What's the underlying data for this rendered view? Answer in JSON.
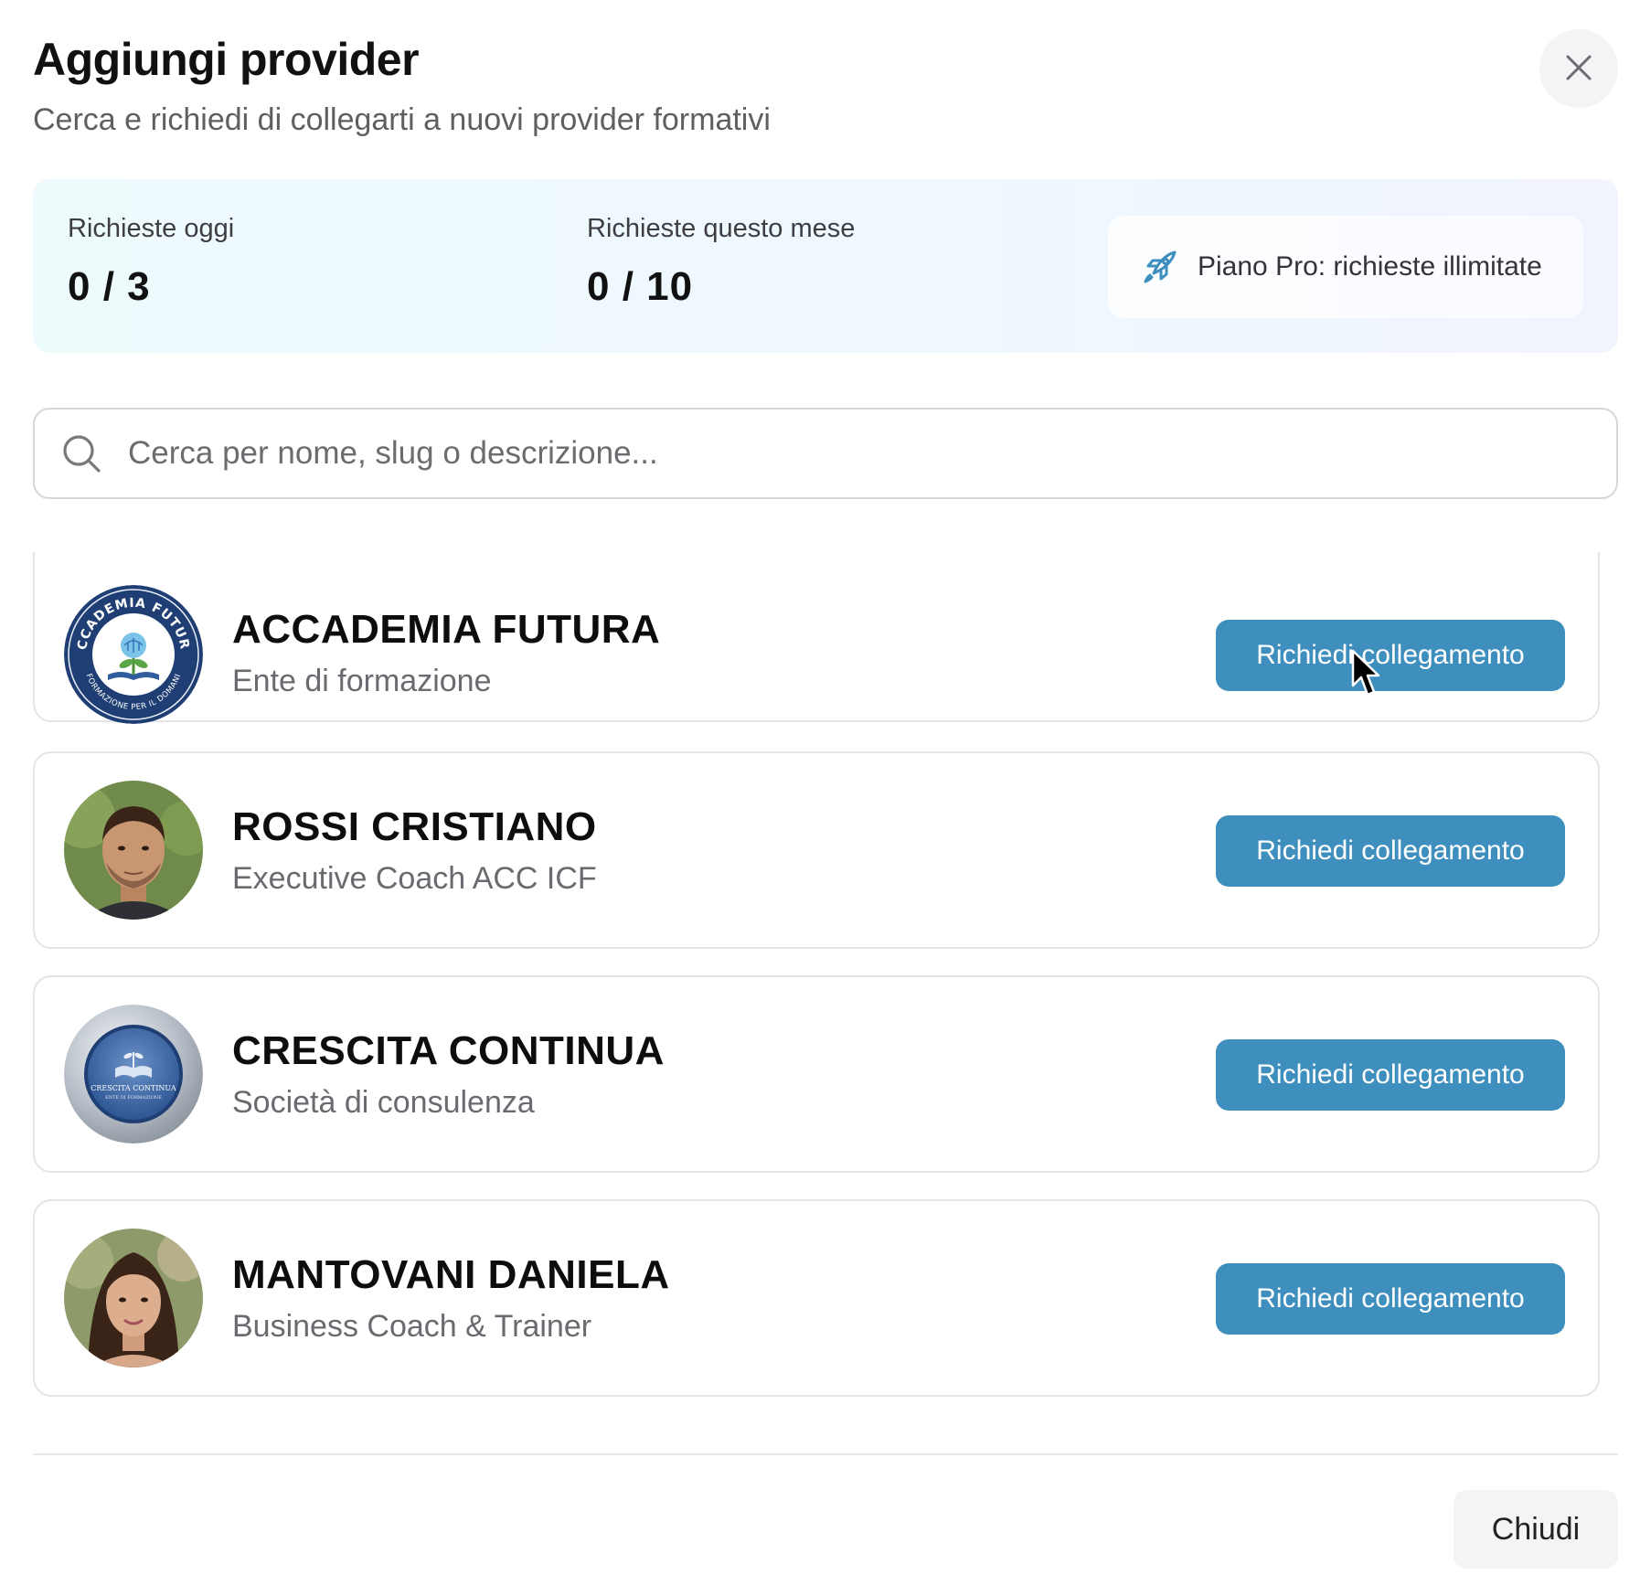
{
  "dialog": {
    "title": "Aggiungi provider",
    "subtitle": "Cerca e richiedi di collegarti a nuovi provider formativi",
    "close_icon": "close-icon"
  },
  "quota": {
    "today_label": "Richieste oggi",
    "today_value": "0 / 3",
    "month_label": "Richieste questo mese",
    "month_value": "0 / 10",
    "plan_text": "Piano Pro: richieste illimitate",
    "plan_icon": "rocket-icon"
  },
  "search": {
    "placeholder": "Cerca per nome, slug o descrizione...",
    "value": ""
  },
  "providers": [
    {
      "name": "ACCADEMIA FUTURA",
      "description": "Ente di formazione",
      "action": "Richiedi collegamento",
      "logo_text_top": "ACCADEMIA FUTURA",
      "logo_text_bottom": "FORMAZIONE PER IL DOMANI"
    },
    {
      "name": "ROSSI CRISTIANO",
      "description": "Executive Coach ACC ICF",
      "action": "Richiedi collegamento"
    },
    {
      "name": "CRESCITA CONTINUA",
      "description": "Società di consulenza",
      "action": "Richiedi collegamento",
      "logo_text_top": "CRESCITA CONTINUA",
      "logo_text_bottom": "ENTE DI FORMAZIONE"
    },
    {
      "name": "MANTOVANI DANIELA",
      "description": "Business Coach & Trainer",
      "action": "Richiedi collegamento"
    }
  ],
  "footer": {
    "close_label": "Chiudi"
  },
  "colors": {
    "primary_button": "#3e8fbe",
    "quota_bg": "#eef9fd",
    "accent_icon": "#3e8fbe"
  }
}
